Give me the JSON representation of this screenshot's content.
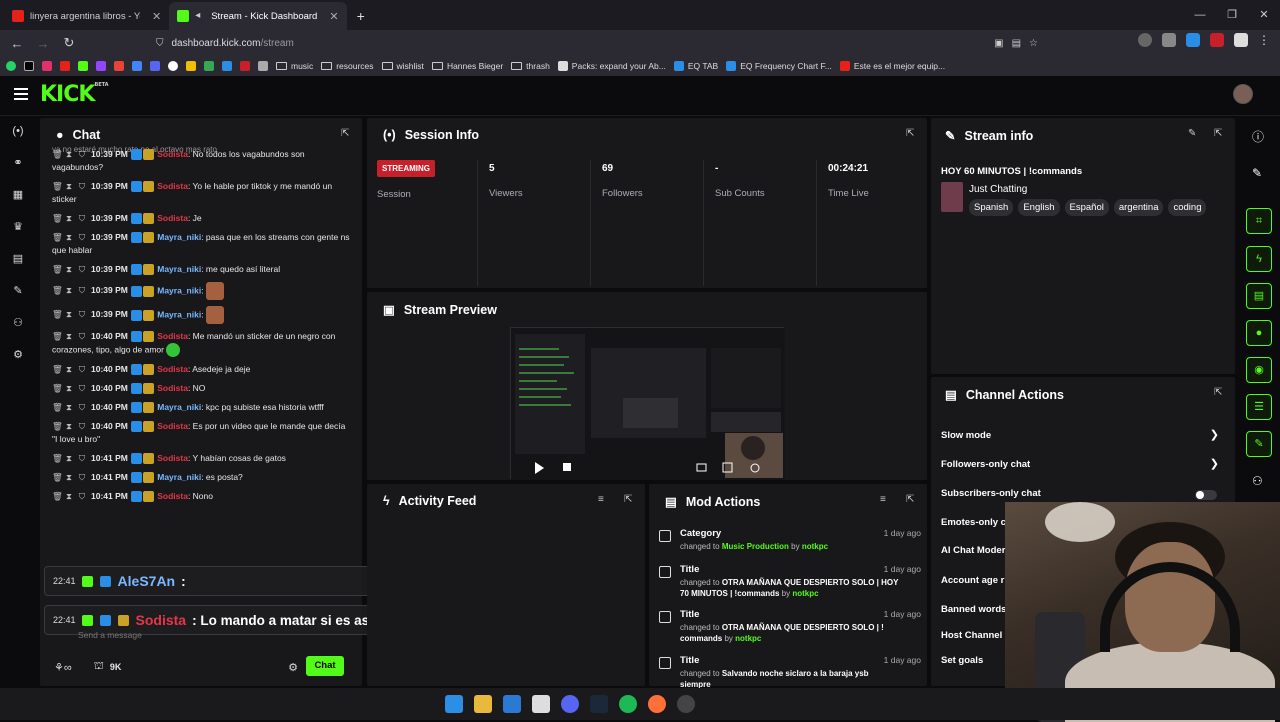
{
  "browser": {
    "tabs": [
      {
        "label": "linyera argentina libros - YouTube"
      },
      {
        "label": "Stream - Kick Dashboard"
      }
    ],
    "url_host": "dashboard.kick.com",
    "url_path": "/stream",
    "bookmarks": [
      "music",
      "resources",
      "wishlist",
      "Hannes Bieger",
      "thrash",
      "Packs: expand your Ab...",
      "EQ TAB",
      "EQ Frequency Chart F...",
      "Este es el mejor equip..."
    ]
  },
  "kick": {
    "logo": "KICK",
    "logo_badge": "BETA"
  },
  "chat": {
    "title": "Chat",
    "top_cut": "ya no estaré mucho rato no al octavo mas rato",
    "messages": [
      {
        "time": "10:39 PM",
        "user": "Sodista",
        "color": "sod",
        "text": ": No todos los vagabundos son vagabundos?"
      },
      {
        "time": "10:39 PM",
        "user": "Sodista",
        "color": "sod",
        "text": ": Yo le hable por tiktok y me mandó un sticker"
      },
      {
        "time": "10:39 PM",
        "user": "Sodista",
        "color": "sod",
        "text": ": Je"
      },
      {
        "time": "10:39 PM",
        "user": "Mayra_niki",
        "color": "may",
        "text": ": pasa que en los streams con gente ns que hablar"
      },
      {
        "time": "10:39 PM",
        "user": "Mayra_niki",
        "color": "may",
        "text": ": me quedo así literal"
      },
      {
        "time": "10:39 PM",
        "user": "Mayra_niki",
        "color": "may",
        "text": ": ",
        "emote": true
      },
      {
        "time": "10:39 PM",
        "user": "Mayra_niki",
        "color": "may",
        "text": ": ",
        "emote": true
      },
      {
        "time": "10:40 PM",
        "user": "Sodista",
        "color": "sod",
        "text": ": Me mandó un sticker de un negro con corazones, tipo, algo de amor"
      },
      {
        "time": "10:40 PM",
        "user": "Sodista",
        "color": "sod",
        "text": ": Asedeje ja deje"
      },
      {
        "time": "10:40 PM",
        "user": "Sodista",
        "color": "sod",
        "text": ": NO"
      },
      {
        "time": "10:40 PM",
        "user": "Mayra_niki",
        "color": "may",
        "text": ": kpc pq subiste esa historia wtfff"
      },
      {
        "time": "10:40 PM",
        "user": "Sodista",
        "color": "sod",
        "text": ": Es por un video que le mande que decía \"I love u bro\""
      },
      {
        "time": "10:41 PM",
        "user": "Sodista",
        "color": "sod",
        "text": ": Y habían cosas de gatos"
      },
      {
        "time": "10:41 PM",
        "user": "Mayra_niki",
        "color": "may",
        "text": ": es posta?"
      },
      {
        "time": "10:41 PM",
        "user": "Sodista",
        "color": "sod",
        "text": ": Nono"
      }
    ],
    "overlay1": {
      "time": "22:41",
      "user": "AleS7An",
      "text": ":"
    },
    "overlay2": {
      "time": "22:41",
      "user": "Sodista",
      "text": ": Lo mando a matar si es así"
    },
    "placeholder": "Send a message",
    "kicks": "9K",
    "send_label": "Chat"
  },
  "session": {
    "title": "Session Info",
    "status": "STREAMING",
    "status_label": "Session",
    "stats": [
      {
        "value": "5",
        "label": "Viewers"
      },
      {
        "value": "69",
        "label": "Followers"
      },
      {
        "value": "-",
        "label": "Sub Counts"
      },
      {
        "value": "00:24:21",
        "label": "Time Live"
      }
    ]
  },
  "preview": {
    "title": "Stream Preview"
  },
  "stream_info": {
    "title": "Stream info",
    "stream_title": "HOY 60 MINUTOS | !commands",
    "category": "Just Chatting",
    "tags": [
      "Spanish",
      "English",
      "Español",
      "argentina",
      "coding"
    ]
  },
  "channel_actions": {
    "title": "Channel Actions",
    "rows": [
      "Slow mode",
      "Followers-only chat",
      "Subscribers-only chat",
      "Emotes-only c",
      "AI Chat Moder",
      "Account age r",
      "Banned words",
      "Host Channel",
      "Set goals"
    ]
  },
  "activity": {
    "title": "Activity Feed"
  },
  "mod_actions": {
    "title": "Mod Actions",
    "items": [
      {
        "type": "Category",
        "pre": "changed to ",
        "value": "Music Production",
        "by": " by ",
        "user": "notkpc",
        "ago": "1 day ago"
      },
      {
        "type": "Title",
        "pre": "changed to ",
        "value": "OTRA MAÑANA QUE DESPIERTO SOLO | HOY 70 MINUTOS | !commands",
        "by": " by ",
        "user": "notkpc",
        "ago": "1 day ago"
      },
      {
        "type": "Title",
        "pre": "changed to ",
        "value": "OTRA MAÑANA QUE DESPIERTO SOLO | ! commands",
        "by": " by ",
        "user": "notkpc",
        "ago": "1 day ago"
      },
      {
        "type": "Title",
        "pre": "changed to ",
        "value": "Salvando noche siclaro a la baraja ysb siempre",
        "by": "",
        "user": "",
        "ago": "1 day ago"
      }
    ]
  },
  "colors": {
    "accent": "#53fc18",
    "streaming": "#c8202b",
    "sodista": "#e3364b",
    "mayra": "#7ab8ff"
  }
}
